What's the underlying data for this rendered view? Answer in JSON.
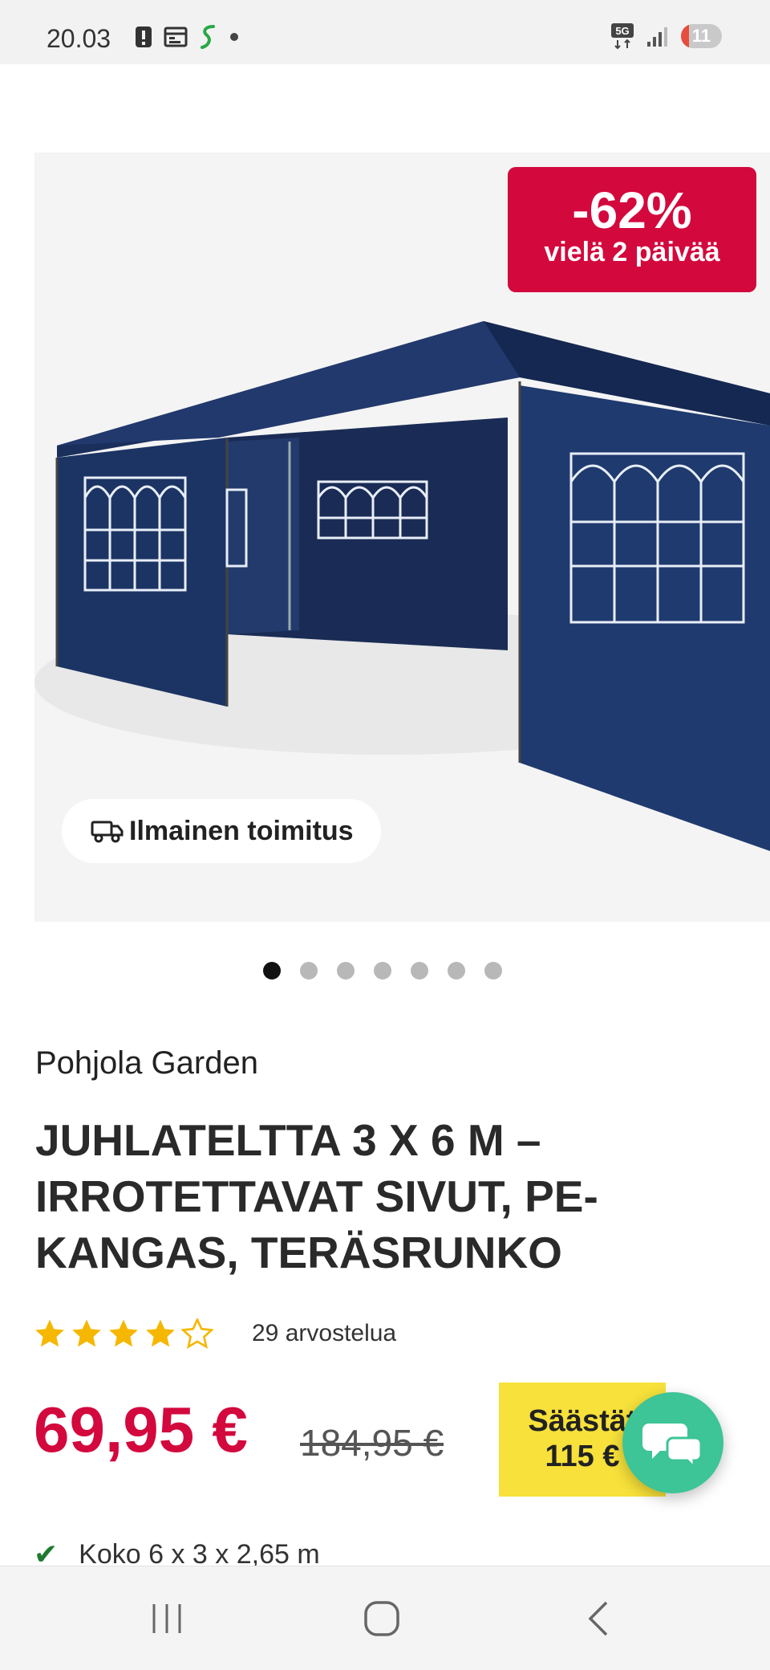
{
  "status_bar": {
    "time": "20.03",
    "network": "5G",
    "battery": "11",
    "icons": [
      "alert-icon",
      "calendar-icon",
      "s-app-icon",
      "dot-icon",
      "5g-icon",
      "signal-icon",
      "battery-icon"
    ]
  },
  "product": {
    "discount_percent": "-62%",
    "discount_note": "vielä 2 päivää",
    "free_shipping": "Ilmainen toimitus",
    "image_count": 7,
    "active_image": 1,
    "brand": "Pohjola Garden",
    "title": "JUHLATELTTA 3 X 6 M – IRROTETTAVAT SIVUT, PE-KANGAS, TERÄSRUNKO",
    "rating_value": 4,
    "rating_max": 5,
    "review_count": "29 arvostelua",
    "price": "69,95 €",
    "old_price": "184,95 €",
    "save_label": "Säästät",
    "save_amount": "115 €",
    "features": [
      "Koko 6 x 3 x 2,65 m"
    ]
  },
  "colors": {
    "accent_red": "#d3083d",
    "save_yellow": "#f7e13a",
    "chat_green": "#3dc497",
    "tent_blue": "#1d3461"
  },
  "nav": {
    "buttons": [
      "recent-apps",
      "home",
      "back"
    ]
  }
}
